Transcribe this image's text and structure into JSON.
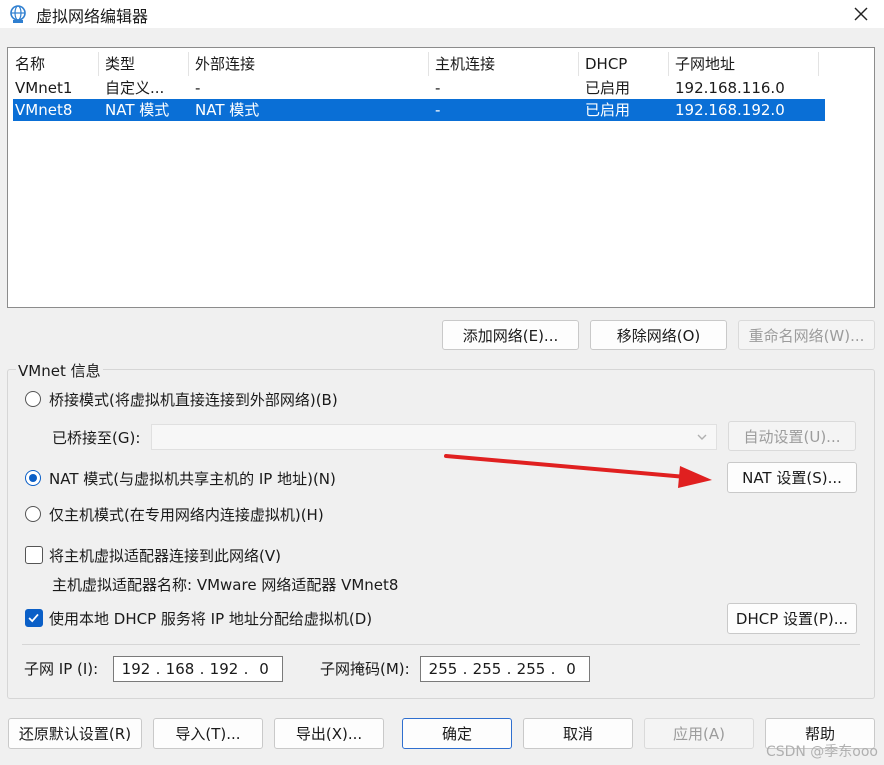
{
  "window": {
    "title": "虚拟网络编辑器"
  },
  "table": {
    "headers": [
      "名称",
      "类型",
      "外部连接",
      "主机连接",
      "DHCP",
      "子网地址"
    ],
    "rows": [
      [
        "VMnet1",
        "自定义...",
        "-",
        "-",
        "已启用",
        "192.168.116.0"
      ],
      [
        "VMnet8",
        "NAT 模式",
        "NAT 模式",
        "-",
        "已启用",
        "192.168.192.0"
      ]
    ],
    "selected_index": 1
  },
  "list_buttons": {
    "add": "添加网络(E)...",
    "remove": "移除网络(O)",
    "rename": "重命名网络(W)..."
  },
  "vmnet_info": {
    "group_label": "VMnet 信息",
    "bridge_label": "桥接模式(将虚拟机直接连接到外部网络)(B)",
    "bridged_to_label": "已桥接至(G):",
    "bridged_to_value": "",
    "auto_settings": "自动设置(U)...",
    "nat_label": "NAT 模式(与虚拟机共享主机的 IP 地址)(N)",
    "nat_settings": "NAT 设置(S)...",
    "host_only_label": "仅主机模式(在专用网络内连接虚拟机)(H)",
    "mode_selected": "nat",
    "connect_adapter_label": "将主机虚拟适配器连接到此网络(V)",
    "connect_adapter_checked": false,
    "adapter_name_label": "主机虚拟适配器名称: VMware 网络适配器 VMnet8",
    "dhcp_label": "使用本地 DHCP 服务将 IP 地址分配给虚拟机(D)",
    "dhcp_checked": true,
    "dhcp_settings": "DHCP 设置(P)...",
    "subnet_ip_label": "子网 IP (I):",
    "subnet_ip": [
      "192",
      "168",
      "192",
      "0"
    ],
    "subnet_mask_label": "子网掩码(M):",
    "subnet_mask": [
      "255",
      "255",
      "255",
      "0"
    ]
  },
  "footer": {
    "restore": "还原默认设置(R)",
    "import": "导入(T)...",
    "export": "导出(X)...",
    "ok": "确定",
    "cancel": "取消",
    "apply": "应用(A)",
    "help": "帮助"
  },
  "watermark": "CSDN @季东ooo",
  "colors": {
    "selection": "#0a6fd6",
    "accent": "#0a5fc7",
    "annotation_arrow": "#e02020"
  }
}
